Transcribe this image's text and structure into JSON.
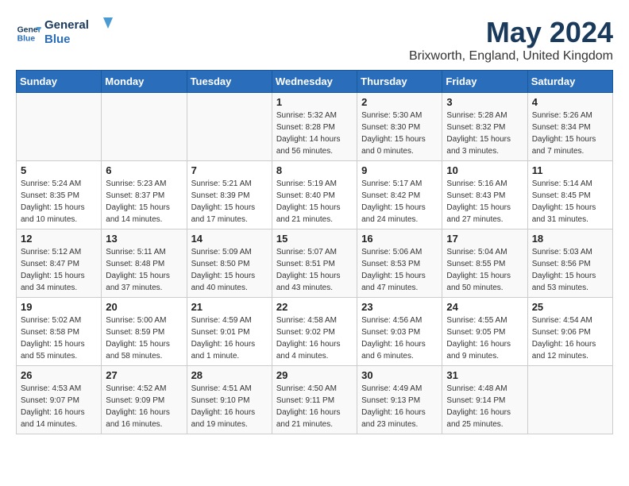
{
  "header": {
    "logo_line1": "General",
    "logo_line2": "Blue",
    "month_year": "May 2024",
    "location": "Brixworth, England, United Kingdom"
  },
  "days_of_week": [
    "Sunday",
    "Monday",
    "Tuesday",
    "Wednesday",
    "Thursday",
    "Friday",
    "Saturday"
  ],
  "weeks": [
    [
      {
        "day": "",
        "sunrise": "",
        "sunset": "",
        "daylight": "",
        "empty": true
      },
      {
        "day": "",
        "sunrise": "",
        "sunset": "",
        "daylight": "",
        "empty": true
      },
      {
        "day": "",
        "sunrise": "",
        "sunset": "",
        "daylight": "",
        "empty": true
      },
      {
        "day": "1",
        "sunrise": "Sunrise: 5:32 AM",
        "sunset": "Sunset: 8:28 PM",
        "daylight": "Daylight: 14 hours and 56 minutes.",
        "empty": false
      },
      {
        "day": "2",
        "sunrise": "Sunrise: 5:30 AM",
        "sunset": "Sunset: 8:30 PM",
        "daylight": "Daylight: 15 hours and 0 minutes.",
        "empty": false
      },
      {
        "day": "3",
        "sunrise": "Sunrise: 5:28 AM",
        "sunset": "Sunset: 8:32 PM",
        "daylight": "Daylight: 15 hours and 3 minutes.",
        "empty": false
      },
      {
        "day": "4",
        "sunrise": "Sunrise: 5:26 AM",
        "sunset": "Sunset: 8:34 PM",
        "daylight": "Daylight: 15 hours and 7 minutes.",
        "empty": false
      }
    ],
    [
      {
        "day": "5",
        "sunrise": "Sunrise: 5:24 AM",
        "sunset": "Sunset: 8:35 PM",
        "daylight": "Daylight: 15 hours and 10 minutes.",
        "empty": false
      },
      {
        "day": "6",
        "sunrise": "Sunrise: 5:23 AM",
        "sunset": "Sunset: 8:37 PM",
        "daylight": "Daylight: 15 hours and 14 minutes.",
        "empty": false
      },
      {
        "day": "7",
        "sunrise": "Sunrise: 5:21 AM",
        "sunset": "Sunset: 8:39 PM",
        "daylight": "Daylight: 15 hours and 17 minutes.",
        "empty": false
      },
      {
        "day": "8",
        "sunrise": "Sunrise: 5:19 AM",
        "sunset": "Sunset: 8:40 PM",
        "daylight": "Daylight: 15 hours and 21 minutes.",
        "empty": false
      },
      {
        "day": "9",
        "sunrise": "Sunrise: 5:17 AM",
        "sunset": "Sunset: 8:42 PM",
        "daylight": "Daylight: 15 hours and 24 minutes.",
        "empty": false
      },
      {
        "day": "10",
        "sunrise": "Sunrise: 5:16 AM",
        "sunset": "Sunset: 8:43 PM",
        "daylight": "Daylight: 15 hours and 27 minutes.",
        "empty": false
      },
      {
        "day": "11",
        "sunrise": "Sunrise: 5:14 AM",
        "sunset": "Sunset: 8:45 PM",
        "daylight": "Daylight: 15 hours and 31 minutes.",
        "empty": false
      }
    ],
    [
      {
        "day": "12",
        "sunrise": "Sunrise: 5:12 AM",
        "sunset": "Sunset: 8:47 PM",
        "daylight": "Daylight: 15 hours and 34 minutes.",
        "empty": false
      },
      {
        "day": "13",
        "sunrise": "Sunrise: 5:11 AM",
        "sunset": "Sunset: 8:48 PM",
        "daylight": "Daylight: 15 hours and 37 minutes.",
        "empty": false
      },
      {
        "day": "14",
        "sunrise": "Sunrise: 5:09 AM",
        "sunset": "Sunset: 8:50 PM",
        "daylight": "Daylight: 15 hours and 40 minutes.",
        "empty": false
      },
      {
        "day": "15",
        "sunrise": "Sunrise: 5:07 AM",
        "sunset": "Sunset: 8:51 PM",
        "daylight": "Daylight: 15 hours and 43 minutes.",
        "empty": false
      },
      {
        "day": "16",
        "sunrise": "Sunrise: 5:06 AM",
        "sunset": "Sunset: 8:53 PM",
        "daylight": "Daylight: 15 hours and 47 minutes.",
        "empty": false
      },
      {
        "day": "17",
        "sunrise": "Sunrise: 5:04 AM",
        "sunset": "Sunset: 8:55 PM",
        "daylight": "Daylight: 15 hours and 50 minutes.",
        "empty": false
      },
      {
        "day": "18",
        "sunrise": "Sunrise: 5:03 AM",
        "sunset": "Sunset: 8:56 PM",
        "daylight": "Daylight: 15 hours and 53 minutes.",
        "empty": false
      }
    ],
    [
      {
        "day": "19",
        "sunrise": "Sunrise: 5:02 AM",
        "sunset": "Sunset: 8:58 PM",
        "daylight": "Daylight: 15 hours and 55 minutes.",
        "empty": false
      },
      {
        "day": "20",
        "sunrise": "Sunrise: 5:00 AM",
        "sunset": "Sunset: 8:59 PM",
        "daylight": "Daylight: 15 hours and 58 minutes.",
        "empty": false
      },
      {
        "day": "21",
        "sunrise": "Sunrise: 4:59 AM",
        "sunset": "Sunset: 9:01 PM",
        "daylight": "Daylight: 16 hours and 1 minute.",
        "empty": false
      },
      {
        "day": "22",
        "sunrise": "Sunrise: 4:58 AM",
        "sunset": "Sunset: 9:02 PM",
        "daylight": "Daylight: 16 hours and 4 minutes.",
        "empty": false
      },
      {
        "day": "23",
        "sunrise": "Sunrise: 4:56 AM",
        "sunset": "Sunset: 9:03 PM",
        "daylight": "Daylight: 16 hours and 6 minutes.",
        "empty": false
      },
      {
        "day": "24",
        "sunrise": "Sunrise: 4:55 AM",
        "sunset": "Sunset: 9:05 PM",
        "daylight": "Daylight: 16 hours and 9 minutes.",
        "empty": false
      },
      {
        "day": "25",
        "sunrise": "Sunrise: 4:54 AM",
        "sunset": "Sunset: 9:06 PM",
        "daylight": "Daylight: 16 hours and 12 minutes.",
        "empty": false
      }
    ],
    [
      {
        "day": "26",
        "sunrise": "Sunrise: 4:53 AM",
        "sunset": "Sunset: 9:07 PM",
        "daylight": "Daylight: 16 hours and 14 minutes.",
        "empty": false
      },
      {
        "day": "27",
        "sunrise": "Sunrise: 4:52 AM",
        "sunset": "Sunset: 9:09 PM",
        "daylight": "Daylight: 16 hours and 16 minutes.",
        "empty": false
      },
      {
        "day": "28",
        "sunrise": "Sunrise: 4:51 AM",
        "sunset": "Sunset: 9:10 PM",
        "daylight": "Daylight: 16 hours and 19 minutes.",
        "empty": false
      },
      {
        "day": "29",
        "sunrise": "Sunrise: 4:50 AM",
        "sunset": "Sunset: 9:11 PM",
        "daylight": "Daylight: 16 hours and 21 minutes.",
        "empty": false
      },
      {
        "day": "30",
        "sunrise": "Sunrise: 4:49 AM",
        "sunset": "Sunset: 9:13 PM",
        "daylight": "Daylight: 16 hours and 23 minutes.",
        "empty": false
      },
      {
        "day": "31",
        "sunrise": "Sunrise: 4:48 AM",
        "sunset": "Sunset: 9:14 PM",
        "daylight": "Daylight: 16 hours and 25 minutes.",
        "empty": false
      },
      {
        "day": "",
        "sunrise": "",
        "sunset": "",
        "daylight": "",
        "empty": true
      }
    ]
  ]
}
